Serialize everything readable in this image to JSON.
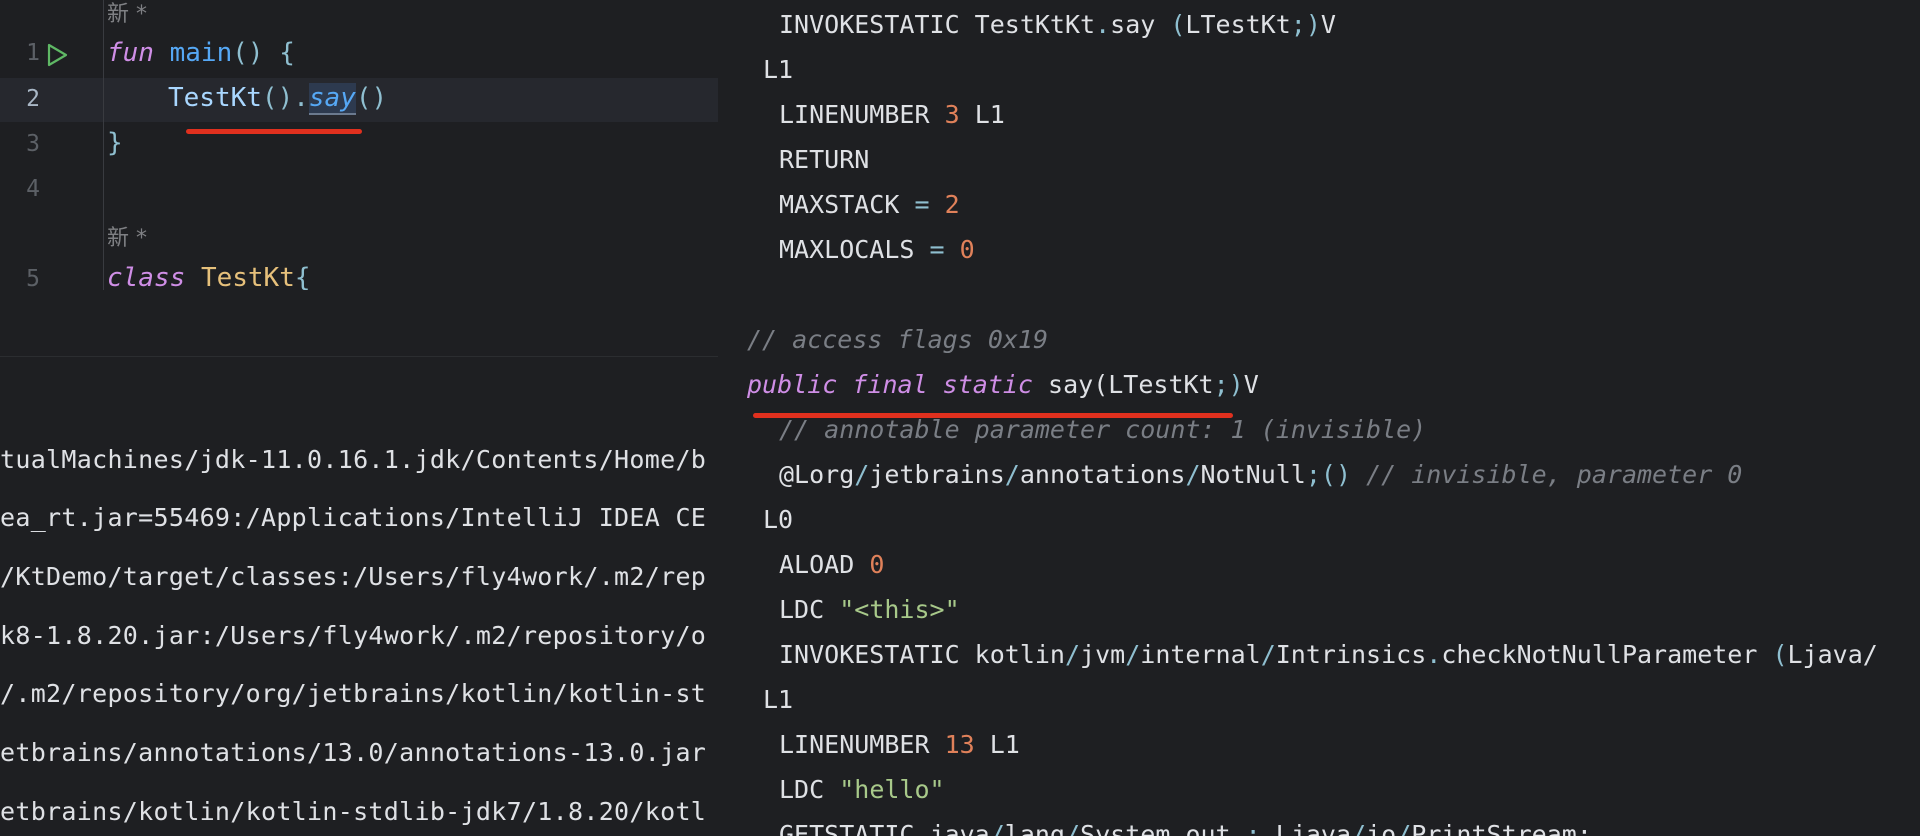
{
  "editor": {
    "hints": [
      "新 *",
      "新 *"
    ],
    "line_numbers": [
      "1",
      "2",
      "3",
      "4",
      "5"
    ],
    "lines": {
      "l1": {
        "kw": "fun",
        "name": "main",
        "rest": "() {"
      },
      "l2": {
        "cls": "TestKt",
        "p1": "().",
        "fn": "say",
        "p2": "()"
      },
      "l3": {
        "text": "}"
      },
      "l5": {
        "kw": "class",
        "cls": "TestKt",
        "rest": "{"
      }
    }
  },
  "console": {
    "lines": [
      "tualMachines/jdk-11.0.16.1.jdk/Contents/Home/b",
      "ea_rt.jar=55469:/Applications/IntelliJ IDEA CE",
      "/KtDemo/target/classes:/Users/fly4work/.m2/rep",
      "k8-1.8.20.jar:/Users/fly4work/.m2/repository/o",
      "/.m2/repository/org/jetbrains/kotlin/kotlin-st",
      "etbrains/annotations/13.0/annotations-13.0.jar",
      "etbrains/kotlin/kotlin-stdlib-jdk7/1.8.20/kotl"
    ]
  },
  "bytecode": {
    "l1": {
      "a": "INVOKESTATIC TestKtKt",
      "b": ".",
      "c": "say ",
      "d": "(",
      "e": "LTestKt",
      "f": ";)",
      "g": "V"
    },
    "l2": "L1",
    "l3": {
      "a": "LINENUMBER ",
      "n": "3",
      "b": " L1"
    },
    "l4": "RETURN",
    "l5": {
      "a": "MAXSTACK ",
      "op": "=",
      "n": "2"
    },
    "l6": {
      "a": "MAXLOCALS ",
      "op": "=",
      "n": "0"
    },
    "l7": "// access flags 0x19",
    "l8": {
      "kw": "public final static",
      "a": " say(LTestKt",
      "op": ";)",
      "b": "V"
    },
    "l9": "// annotable parameter count: 1 (invisible)",
    "l10": {
      "a": "@Lorg",
      "s1": "/",
      "b": "jetbrains",
      "s2": "/",
      "c": "annotations",
      "s3": "/",
      "d": "NotNull",
      "e": ";()",
      "com": " // invisible, parameter 0"
    },
    "l11": "L0",
    "l12": {
      "a": "ALOAD ",
      "n": "0"
    },
    "l13": {
      "a": "LDC ",
      "s": "\"<this>\""
    },
    "l14": {
      "a": "INVOKESTATIC kotlin",
      "s1": "/",
      "b": "jvm",
      "s2": "/",
      "c": "internal",
      "s3": "/",
      "d": "Intrinsics",
      "dot": ".",
      "e": "checkNotNullParameter ",
      "f": "(",
      "g": "Ljava/"
    },
    "l15": "L1",
    "l16": {
      "a": "LINENUMBER ",
      "n": "13",
      "b": " L1"
    },
    "l17": {
      "a": "LDC ",
      "s": "\"hello\""
    },
    "l18": {
      "a": "GETSTATIC java",
      "s1": "/",
      "b": "lang",
      "s2": "/",
      "c": "System",
      "d": ".",
      "e": "out ",
      "f": ":",
      "g": " Ljava",
      "s3": "/",
      "h": "io",
      "s4": "/",
      "i": "PrintStream;"
    }
  }
}
